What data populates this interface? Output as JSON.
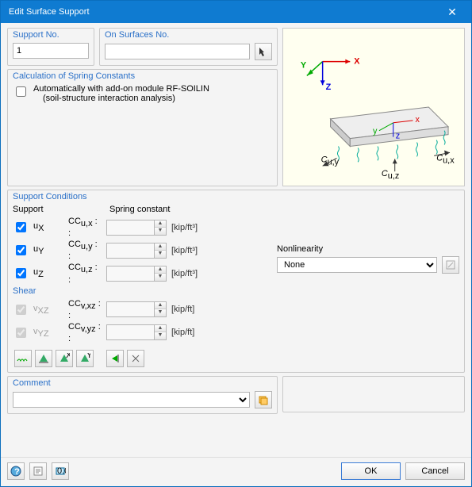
{
  "window": {
    "title": "Edit Surface Support"
  },
  "supportNo": {
    "label": "Support No.",
    "value": "1"
  },
  "onSurfaces": {
    "label": "On Surfaces No.",
    "value": ""
  },
  "calcGroup": {
    "label": "Calculation of Spring Constants",
    "checkbox": "Automatically with add-on module RF-SOILIN",
    "subtext": "(soil-structure interaction analysis)"
  },
  "conditions": {
    "label": "Support Conditions",
    "supportHeader": "Support",
    "springHeader": "Spring constant",
    "shearHeader": "Shear",
    "nonlinLabel": "Nonlinearity",
    "nonlinValue": "None",
    "rows": [
      {
        "check": true,
        "enabled": true,
        "label": "uX",
        "coef": "Cu,x :",
        "val": "",
        "unit": "[kip/ft³]"
      },
      {
        "check": true,
        "enabled": true,
        "label": "uY",
        "coef": "Cu,y :",
        "val": "",
        "unit": "[kip/ft³]"
      },
      {
        "check": true,
        "enabled": true,
        "label": "uZ",
        "coef": "Cu,z :",
        "val": "",
        "unit": "[kip/ft³]"
      },
      {
        "check": true,
        "enabled": false,
        "label": "vXZ",
        "coef": "Cv,xz :",
        "val": "",
        "unit": "[kip/ft]"
      },
      {
        "check": true,
        "enabled": false,
        "label": "vYZ",
        "coef": "Cv,yz :",
        "val": "",
        "unit": "[kip/ft]"
      }
    ]
  },
  "comment": {
    "label": "Comment",
    "value": ""
  },
  "buttons": {
    "ok": "OK",
    "cancel": "Cancel"
  }
}
